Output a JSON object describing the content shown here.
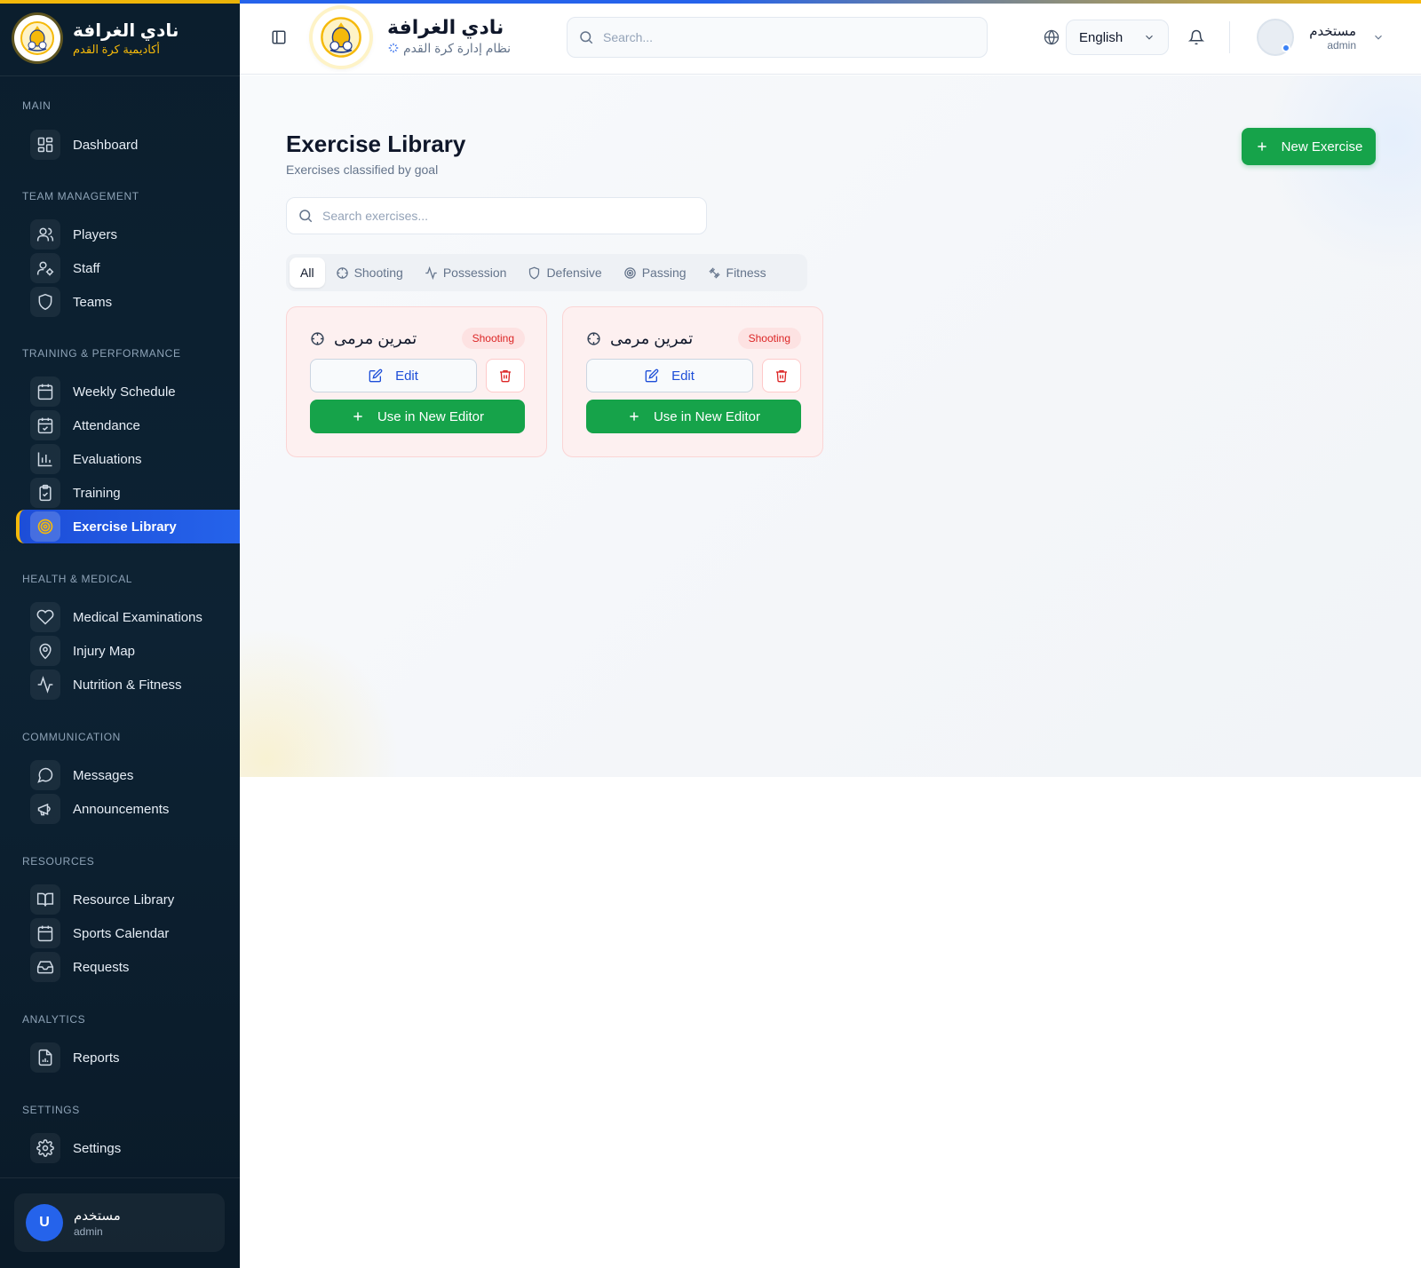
{
  "sidebar": {
    "brand_title": "نادي الغرافة",
    "brand_subtitle": "أكاديمية كرة القدم",
    "sections": [
      {
        "title": "MAIN",
        "items": [
          {
            "label": "Dashboard",
            "icon": "grid-icon"
          }
        ]
      },
      {
        "title": "TEAM MANAGEMENT",
        "items": [
          {
            "label": "Players",
            "icon": "users-icon"
          },
          {
            "label": "Staff",
            "icon": "user-cog-icon"
          },
          {
            "label": "Teams",
            "icon": "shield-icon"
          }
        ]
      },
      {
        "title": "TRAINING & PERFORMANCE",
        "items": [
          {
            "label": "Weekly Schedule",
            "icon": "calendar-icon"
          },
          {
            "label": "Attendance",
            "icon": "calendar-check-icon"
          },
          {
            "label": "Evaluations",
            "icon": "bar-chart-icon"
          },
          {
            "label": "Training",
            "icon": "clipboard-check-icon"
          },
          {
            "label": "Exercise Library",
            "icon": "target-icon",
            "active": true
          }
        ]
      },
      {
        "title": "HEALTH & MEDICAL",
        "items": [
          {
            "label": "Medical Examinations",
            "icon": "heart-icon"
          },
          {
            "label": "Injury Map",
            "icon": "map-pin-icon"
          },
          {
            "label": "Nutrition & Fitness",
            "icon": "activity-icon"
          }
        ]
      },
      {
        "title": "COMMUNICATION",
        "items": [
          {
            "label": "Messages",
            "icon": "message-circle-icon"
          },
          {
            "label": "Announcements",
            "icon": "megaphone-icon"
          }
        ]
      },
      {
        "title": "RESOURCES",
        "items": [
          {
            "label": "Resource Library",
            "icon": "book-open-icon"
          },
          {
            "label": "Sports Calendar",
            "icon": "calendar-icon"
          },
          {
            "label": "Requests",
            "icon": "inbox-icon"
          }
        ]
      },
      {
        "title": "ANALYTICS",
        "items": [
          {
            "label": "Reports",
            "icon": "file-chart-icon"
          }
        ]
      },
      {
        "title": "SETTINGS",
        "items": [
          {
            "label": "Settings",
            "icon": "gear-icon"
          }
        ]
      }
    ],
    "user": {
      "initial": "U",
      "name": "مستخدم",
      "role": "admin"
    }
  },
  "header": {
    "title": "نادي الغرافة",
    "subtitle": "نظام إدارة كرة القدم",
    "search_placeholder": "Search...",
    "language": "English",
    "user_name": "مستخدم",
    "user_role": "admin"
  },
  "main": {
    "title": "Exercise Library",
    "subtitle": "Exercises classified by goal",
    "new_button": "New Exercise",
    "search_placeholder": "Search exercises...",
    "filters": [
      {
        "label": "All",
        "icon": "",
        "active": true
      },
      {
        "label": "Shooting",
        "icon": "crosshair-icon"
      },
      {
        "label": "Possession",
        "icon": "activity-icon"
      },
      {
        "label": "Defensive",
        "icon": "shield-icon"
      },
      {
        "label": "Passing",
        "icon": "target-icon"
      },
      {
        "label": "Fitness",
        "icon": "dumbbell-icon"
      }
    ],
    "cards": [
      {
        "title": "تمرين مرمى",
        "badge": "Shooting",
        "edit_label": "Edit",
        "use_label": "Use in New Editor"
      },
      {
        "title": "تمرين مرمى",
        "badge": "Shooting",
        "edit_label": "Edit",
        "use_label": "Use in New Editor"
      }
    ]
  },
  "colors": {
    "sidebar_bg": "#0b1e2d",
    "accent_blue": "#2563eb",
    "accent_yellow": "#f5b90a",
    "success_green": "#16a34a",
    "danger_red": "#dc2626",
    "card_bg": "#fdf0f0"
  }
}
